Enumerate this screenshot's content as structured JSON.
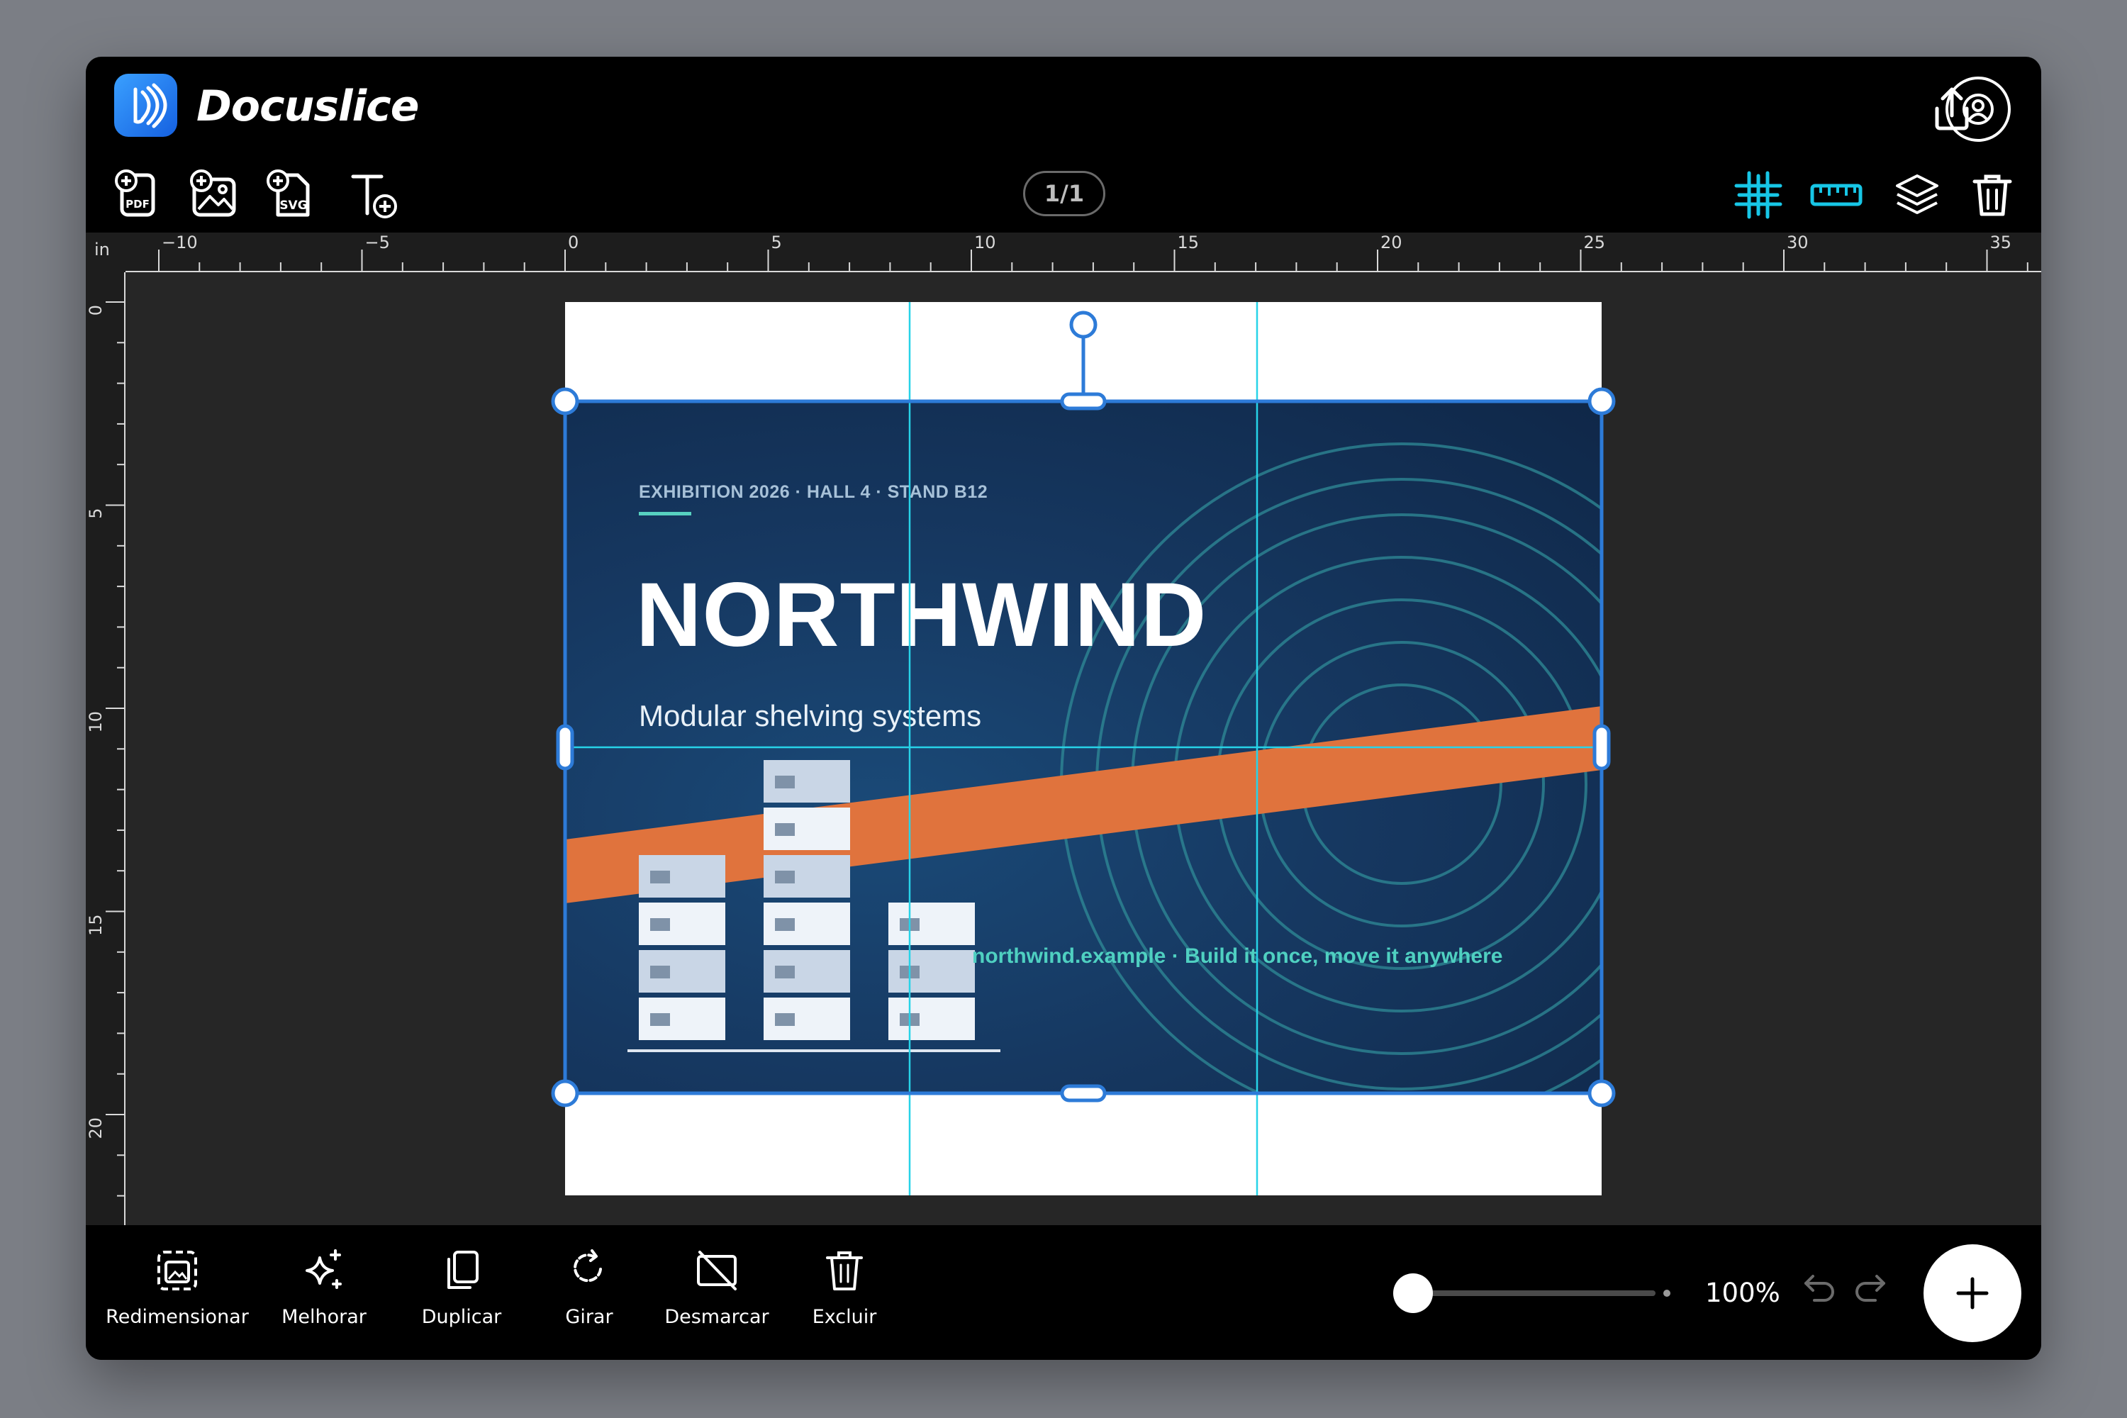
{
  "app": {
    "name": "Docuslice"
  },
  "header": {
    "page_indicator": "1/1"
  },
  "icons": {
    "logo": "docuslice-logo-icon",
    "share": "share-upload-icon",
    "account": "account-circle-icon",
    "add_pdf": "add-pdf-icon",
    "add_image": "add-image-icon",
    "add_svg": "add-svg-icon",
    "add_text": "add-text-icon",
    "grid": "grid-icon",
    "ruler": "ruler-icon",
    "layers": "layers-icon",
    "delete": "trash-icon"
  },
  "colors": {
    "accent": "#17c6e6",
    "selection": "#2d7bd8",
    "poster_orange": "#e0733d",
    "poster_teal": "#4fd0c1"
  },
  "rulers": {
    "unit": "in",
    "top_labels": [
      "-10",
      "-5",
      "0",
      "5",
      "10",
      "15",
      "20",
      "25",
      "30",
      "35"
    ],
    "left_labels": [
      "0",
      "5",
      "10",
      "15",
      "20"
    ]
  },
  "poster": {
    "meta": "EXHIBITION 2026  ·  HALL 4  ·  STAND B12",
    "title": "NORTHWIND",
    "subtitle": "Modular shelving systems",
    "footer": "northwind.example  ·  Build it once, move it anywhere"
  },
  "actions": [
    {
      "label": "Redimensionar",
      "icon": "resize-icon"
    },
    {
      "label": "Melhorar",
      "icon": "sparkle-enhance-icon"
    },
    {
      "label": "Duplicar",
      "icon": "duplicate-icon"
    },
    {
      "label": "Girar",
      "icon": "rotate-icon"
    },
    {
      "label": "Desmarcar",
      "icon": "deselect-icon"
    },
    {
      "label": "Excluir",
      "icon": "trash-icon"
    }
  ],
  "zoom": {
    "label": "100%",
    "level": 0.0
  }
}
